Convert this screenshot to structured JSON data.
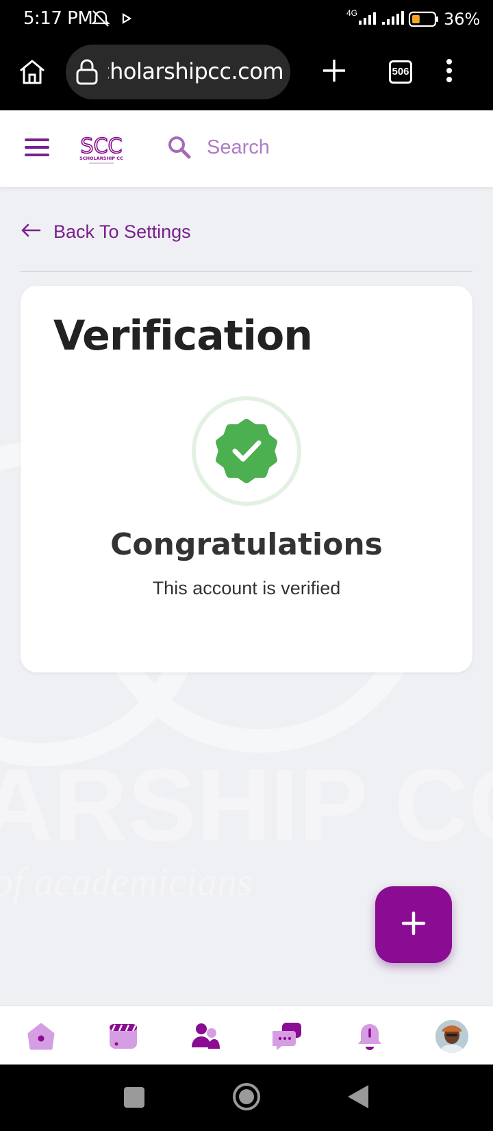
{
  "status_bar": {
    "time": "5:17 PM",
    "network": "4G",
    "battery_percent": "36%",
    "battery_level": 0.36,
    "icons": [
      "silent-icon",
      "play-icon",
      "signal-icon",
      "signal-icon",
      "battery-icon"
    ]
  },
  "browser": {
    "url": "scholarshipcc.com",
    "tab_count": "506",
    "icons": [
      "home-icon",
      "lock-icon",
      "new-tab-icon",
      "tab-switcher-icon",
      "more-vert-icon"
    ]
  },
  "header": {
    "logo_text": "SCC",
    "logo_subtext": "SCHOLARSHIP CC",
    "search_placeholder": "Search"
  },
  "back_link": {
    "label": "Back To Settings"
  },
  "card": {
    "title": "Verification",
    "heading": "Congratulations",
    "message": "This account is verified"
  },
  "watermark": {
    "text": "ARSHIP CC",
    "subtext": "of academicians"
  },
  "bottom_nav": {
    "items": [
      "home-icon",
      "video-icon",
      "people-icon",
      "chat-icon",
      "bell-icon",
      "avatar"
    ]
  },
  "colors": {
    "brand": "#8a0c92",
    "brand_light": "#d59ee3",
    "link": "#7a1f8e",
    "success": "#4caf50",
    "background": "#eff0f4"
  }
}
